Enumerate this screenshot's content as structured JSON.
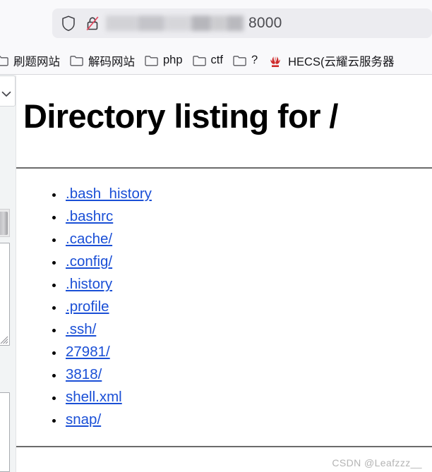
{
  "browser": {
    "address_bar": {
      "shield_icon": "shield-icon",
      "lock_icon": "lock-slash-icon",
      "url_redacted": true,
      "port_text": "8000"
    },
    "bookmarks": [
      {
        "icon": "folder-icon",
        "label": "刷题网站"
      },
      {
        "icon": "folder-icon",
        "label": "解码网站"
      },
      {
        "icon": "folder-icon",
        "label": "php"
      },
      {
        "icon": "folder-icon",
        "label": "ctf"
      },
      {
        "icon": "folder-icon",
        "label": "?"
      },
      {
        "icon": "huawei-icon",
        "label": "HECS(云耀云服务器"
      }
    ]
  },
  "gutter": {
    "select_icon": "chevron-down-icon",
    "scrollbar": "vertical-scrollbar",
    "resize_grip_icon": "resize-grip-icon"
  },
  "page": {
    "title": "Directory listing for /",
    "entries": [
      {
        "name": ".bash_history",
        "type": "file"
      },
      {
        "name": ".bashrc",
        "type": "file"
      },
      {
        "name": ".cache/",
        "type": "directory"
      },
      {
        "name": ".config/",
        "type": "directory"
      },
      {
        "name": ".history",
        "type": "file"
      },
      {
        "name": ".profile",
        "type": "file"
      },
      {
        "name": ".ssh/",
        "type": "directory"
      },
      {
        "name": "27981/",
        "type": "directory"
      },
      {
        "name": "3818/",
        "type": "directory"
      },
      {
        "name": "shell.xml",
        "type": "file"
      },
      {
        "name": "snap/",
        "type": "directory"
      }
    ]
  },
  "watermark": {
    "text": "CSDN @Leafzzz__"
  },
  "colors": {
    "link": "#1a4fd6",
    "chrome_bg": "#f9f9fb",
    "urlbar_bg": "#ececf0",
    "huawei_red": "#cf2b2b",
    "rule": "#6b6b6b",
    "watermark": "#b4b4b4"
  }
}
